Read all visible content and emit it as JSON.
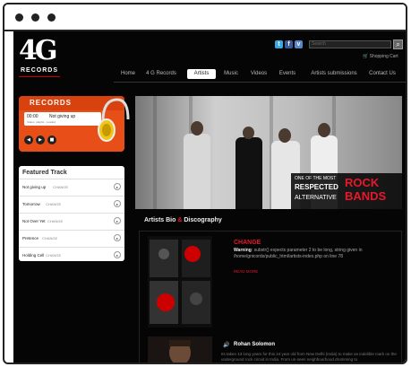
{
  "header": {
    "logo_text": "4G",
    "logo_sub": "RECORDS",
    "social_icons": [
      "twitter-icon",
      "facebook-icon",
      "vimeo-icon",
      "myspace-icon"
    ],
    "search_placeholder": "Search",
    "cart_label": "Shopping Cart"
  },
  "nav": [
    "Home",
    "4 G Records",
    "Artists",
    "Music",
    "Videos",
    "Events",
    "Artists submissions",
    "Contact Us"
  ],
  "nav_active": "Artists",
  "player": {
    "title": "RECORDS",
    "time": "00:00",
    "song": "Not giving up",
    "status": "Status: playlist - Loaded"
  },
  "featured": {
    "title": "Featured Track",
    "tracks": [
      {
        "name": "Not giving up",
        "artist": "CHANGE"
      },
      {
        "name": "Tomorrow",
        "artist": "CHANGE"
      },
      {
        "name": "Not Over Yet",
        "artist": "CHANGE"
      },
      {
        "name": "Pretence",
        "artist": "CHANGE"
      },
      {
        "name": "Holding Cell",
        "artist": "CHANGE"
      }
    ]
  },
  "banner": {
    "line1": "ONE OF THE MOST",
    "line2": "RESPECTED",
    "line3": "ALTERNATIVE",
    "highlight1": "ROCK",
    "highlight2": "BANDS"
  },
  "bio": {
    "title_a": "Artists Bio",
    "title_amp": "&",
    "title_b": "Discography",
    "artist1": {
      "name": "CHANGE",
      "warning_label": "Warning",
      "warning_text": ": substr() expects parameter 2 to be long, string given in /home/gnicords/public_html/artists-index.php on line 78",
      "read_more": "READ MORE"
    },
    "artist2": {
      "name": "Rohan Solomon",
      "text": "Its taken 13 long years for this 24 year old from New Delhi (India) to make an indelible mark on the underground rock circuit in India. From un-seen neighbourhood drumming to"
    }
  },
  "colors": {
    "accent_red": "#e8182a",
    "player_orange": "#e84f18"
  }
}
